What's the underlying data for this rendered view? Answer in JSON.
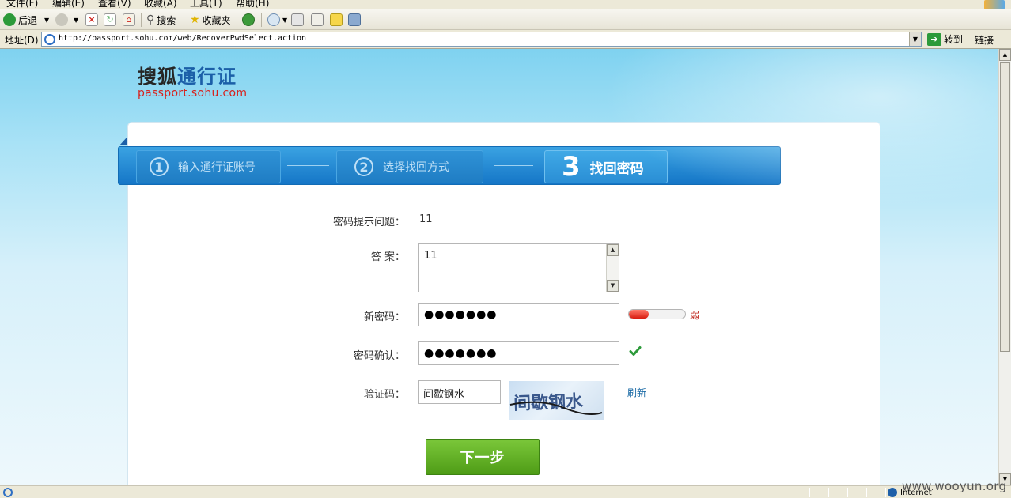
{
  "browser": {
    "menu": [
      "文件(F)",
      "编辑(E)",
      "查看(V)",
      "收藏(A)",
      "工具(T)",
      "帮助(H)"
    ],
    "toolbar": {
      "back_label": "后退",
      "search_label": "搜索",
      "favorites_label": "收藏夹"
    },
    "address": {
      "label": "地址(D)",
      "url": "http://passport.sohu.com/web/RecoverPwdSelect.action",
      "go_label": "转到",
      "links_label": "链接"
    },
    "status": {
      "zone_label": "Internet"
    }
  },
  "logo": {
    "brand": "搜狐",
    "product": "通行证",
    "subtitle": "passport.sohu.com"
  },
  "steps": [
    {
      "number": "①",
      "label": "输入通行证账号"
    },
    {
      "number": "②",
      "label": "选择找回方式"
    },
    {
      "number": "3",
      "label": "找回密码"
    }
  ],
  "form": {
    "question_label": "密码提示问题：",
    "question_value": "11",
    "answer_label": "答 案：",
    "answer_value": "11",
    "new_password_label": "新密码：",
    "new_password_value": "●●●●●●●",
    "strength_level": 0.35,
    "strength_text": "弱",
    "confirm_label": "密码确认：",
    "confirm_value": "●●●●●●●",
    "captcha_label": "验证码：",
    "captcha_value": "间歇钢水",
    "captcha_image_text": "间歇钢水",
    "refresh_label": "刷新",
    "next_label": "下一步"
  },
  "colors": {
    "steps_bar": "#1e82cf",
    "next_button": "#5ca820",
    "strength_weak": "#d81c10",
    "check": "#2c9a3a"
  },
  "watermark": "www.wooyun.org"
}
